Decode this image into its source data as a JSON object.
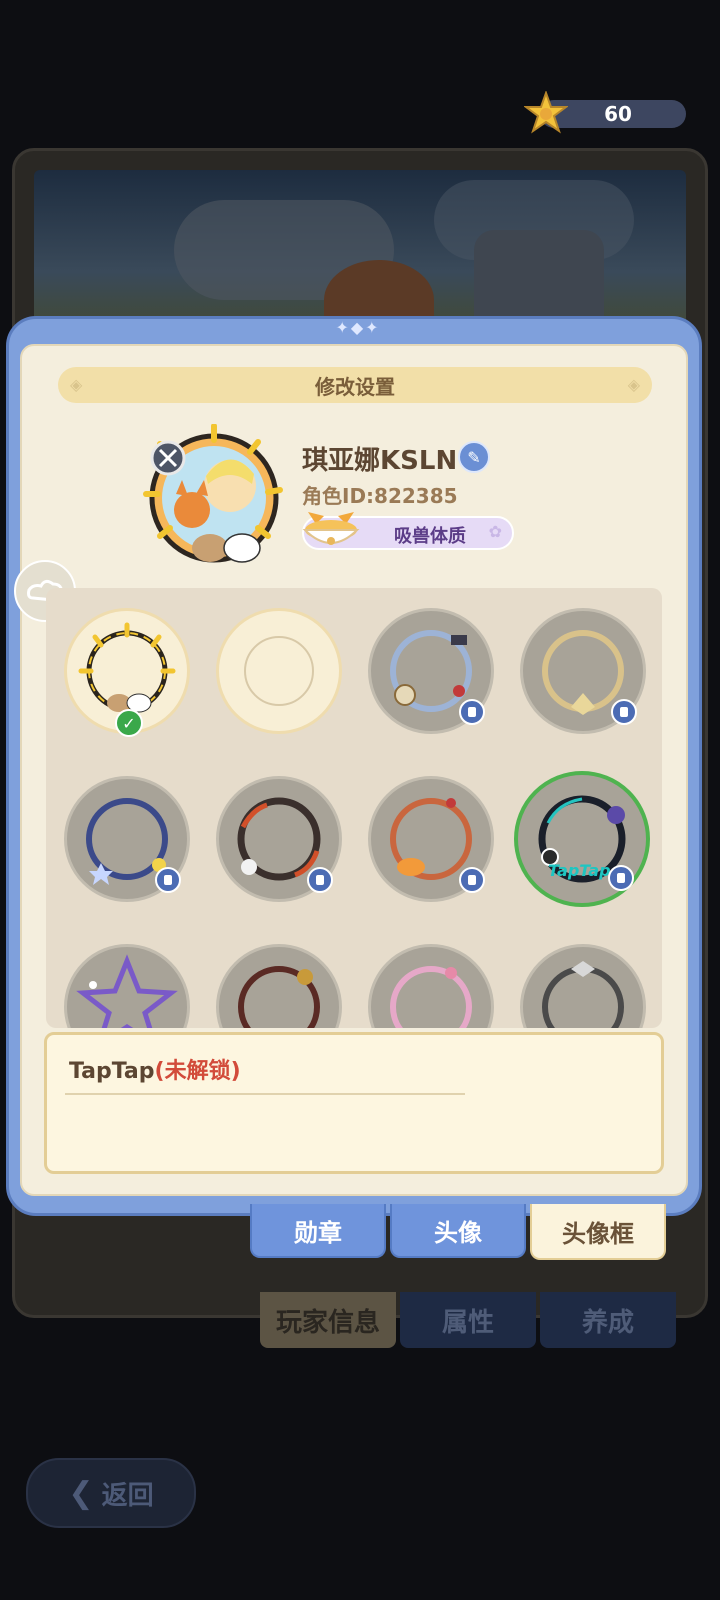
{
  "currency": {
    "value": "60",
    "icon": "star-icon"
  },
  "modal": {
    "title": "修改设置",
    "profile": {
      "name": "琪亚娜KSLN",
      "role_id": "角色ID:822385",
      "trait": "吸兽体质"
    },
    "frame_slots": [
      {
        "state": "equipped"
      },
      {
        "state": "empty"
      },
      {
        "state": "locked"
      },
      {
        "state": "locked"
      },
      {
        "state": "locked"
      },
      {
        "state": "locked"
      },
      {
        "state": "locked"
      },
      {
        "state": "selected_locked",
        "label": "TapTap"
      },
      {
        "state": "locked"
      },
      {
        "state": "locked"
      },
      {
        "state": "locked"
      },
      {
        "state": "locked"
      }
    ],
    "description": {
      "name": "TapTap",
      "status": "(未解锁)"
    },
    "tabs": [
      {
        "label": "勋章"
      },
      {
        "label": "头像"
      },
      {
        "label": "头像框",
        "active": true
      }
    ]
  },
  "background": {
    "tabs": [
      {
        "label": "玩家信息",
        "active": true
      },
      {
        "label": "属性"
      },
      {
        "label": "养成"
      }
    ],
    "back_label": "返回"
  },
  "colors": {
    "modal_blue": "#7fa0dc",
    "parchment": "#f4eedd",
    "selected_green": "#4fb34f",
    "locked_red": "#d24b3a"
  }
}
